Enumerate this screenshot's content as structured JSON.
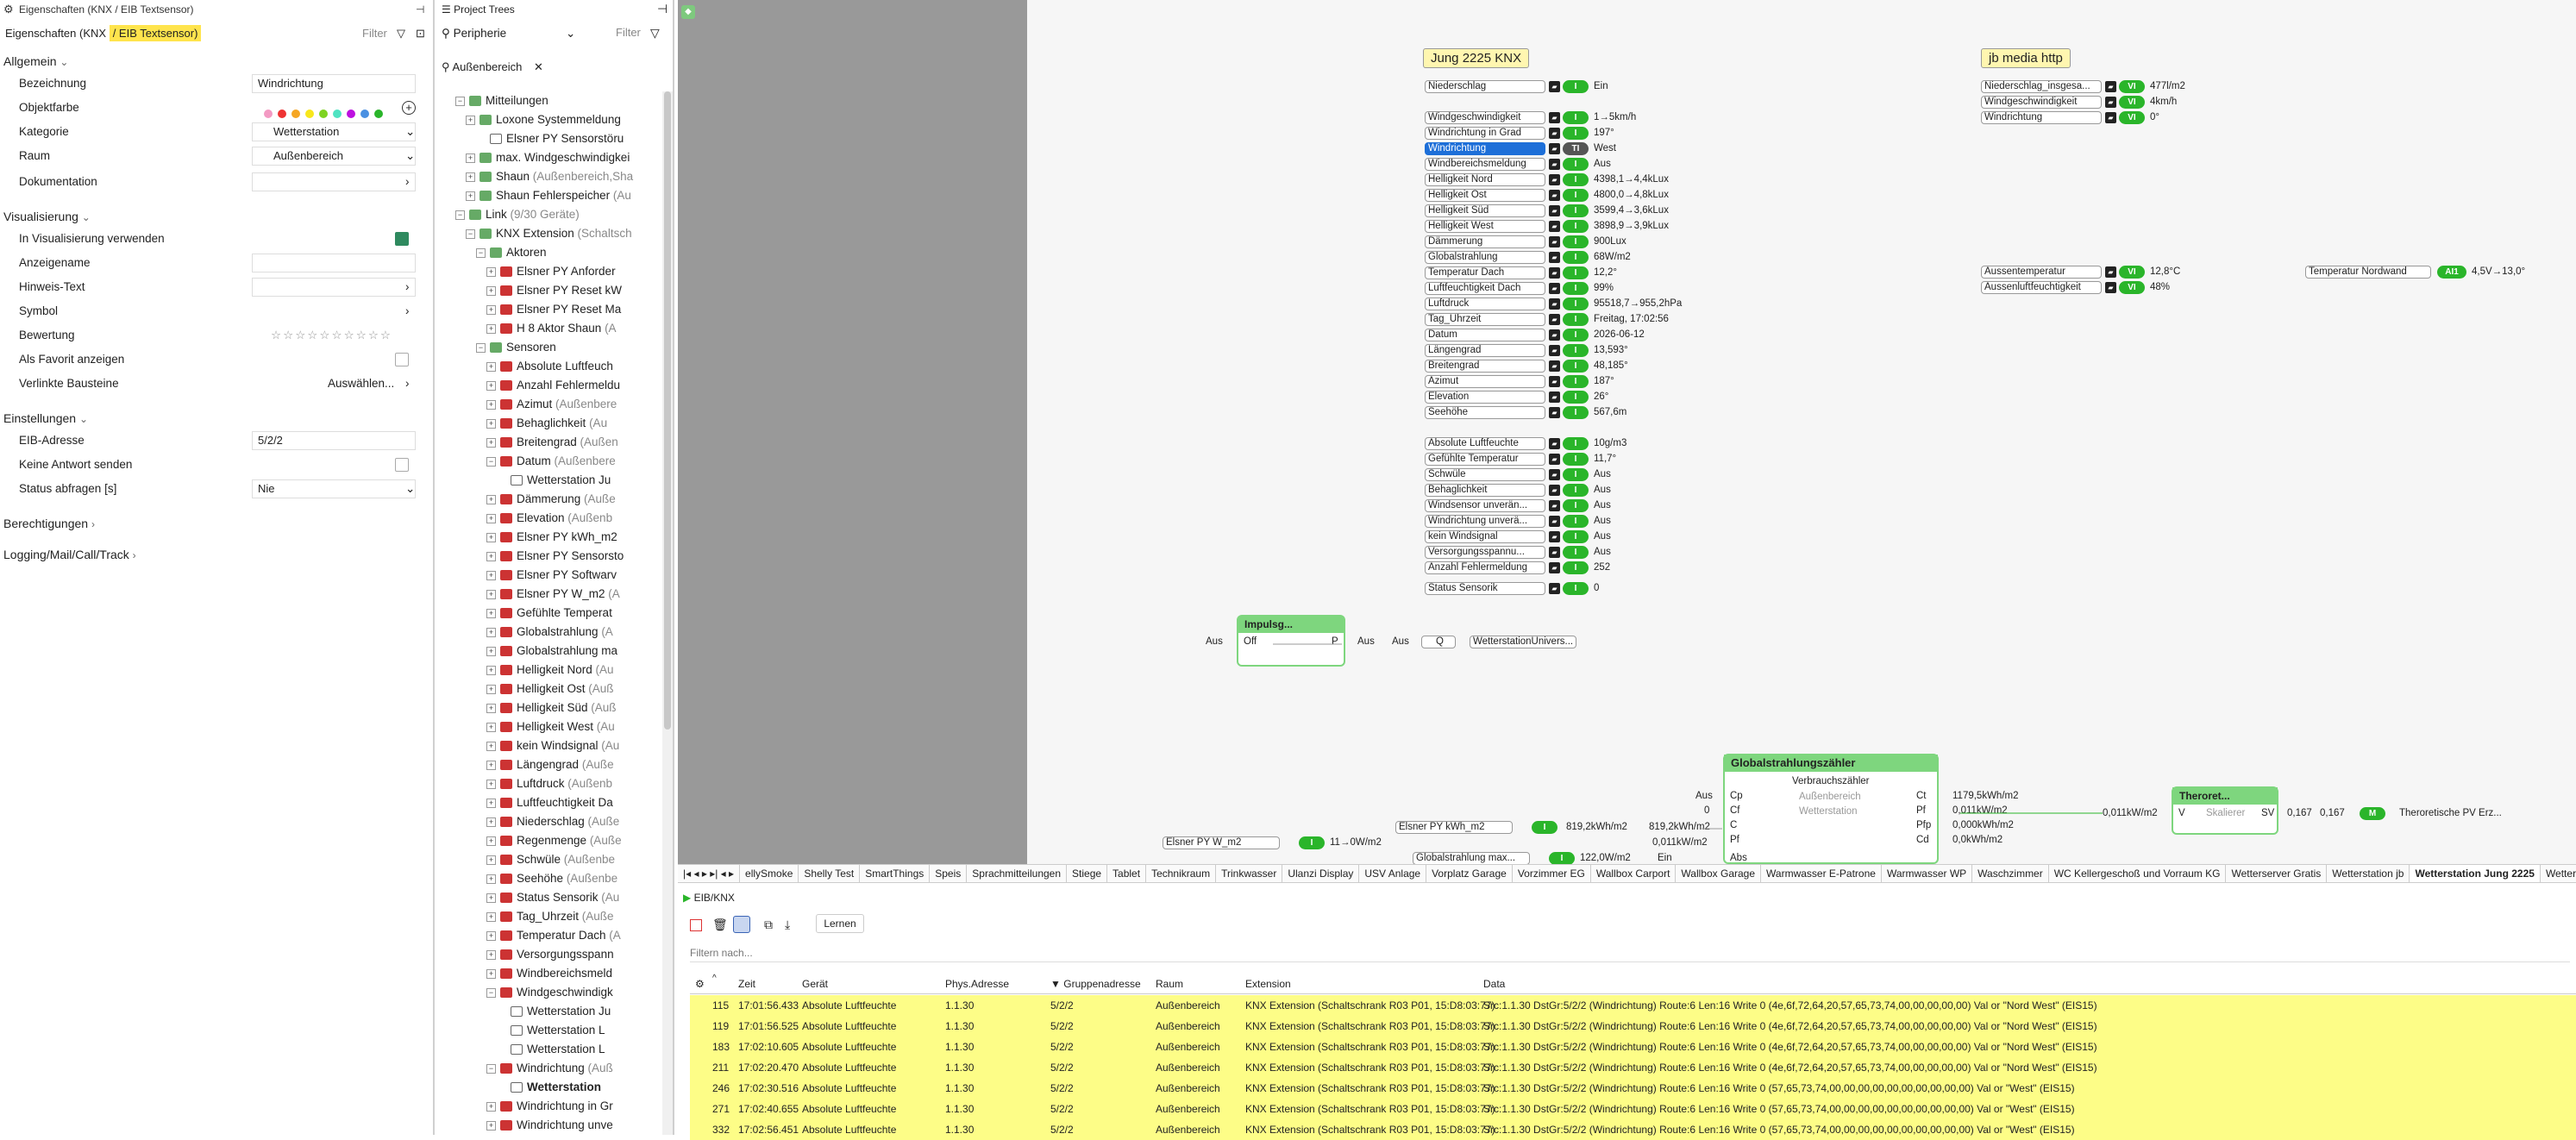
{
  "props": {
    "title": "Eigenschaften (KNX / EIB Textsensor)",
    "subtitle_a": "Eigenschaften (KNX ",
    "subtitle_b": "/ EIB Textsensor)",
    "filter": "Filter",
    "allgemein": "Allgemein",
    "bezeichnung_label": "Bezeichnung",
    "bezeichnung_value": "Windrichtung",
    "objektfarbe_label": "Objektfarbe",
    "kategorie_label": "Kategorie",
    "kategorie_value": "Wetterstation",
    "raum_label": "Raum",
    "raum_value": "Außenbereich",
    "dokumentation_label": "Dokumentation",
    "visualisierung": "Visualisierung",
    "in_vis_label": "In Visualisierung verwenden",
    "anzeigename_label": "Anzeigename",
    "hinweis_label": "Hinweis-Text",
    "symbol_label": "Symbol",
    "bewertung_label": "Bewertung",
    "favorit_label": "Als Favorit anzeigen",
    "verlinkte_label": "Verlinkte Bausteine",
    "verlinkte_value": "Auswählen...",
    "einstellungen": "Einstellungen",
    "eib_label": "EIB-Adresse",
    "eib_value": "5/2/2",
    "keine_antwort_label": "Keine Antwort senden",
    "status_label": "Status abfragen [s]",
    "status_value": "Nie",
    "berechtigungen": "Berechtigungen",
    "logging": "Logging/Mail/Call/Track"
  },
  "tree": {
    "title": "Project Trees",
    "dropdown": "Peripherie",
    "filter": "Filter",
    "breadcrumb": "Außenbereich",
    "nodes": [
      {
        "t": "Mitteilungen",
        "g": ""
      },
      {
        "t": "Loxone Systemmeldung",
        "g": ""
      },
      {
        "t": "Elsner PY Sensorstöru",
        "g": ""
      },
      {
        "t": "max. Windgeschwindigkei",
        "g": ""
      },
      {
        "t": "Shaun",
        "g": " (Außenbereich,Sha"
      },
      {
        "t": "Shaun Fehlerspeicher",
        "g": " (Au"
      },
      {
        "t": "Link",
        "g": " (9/30 Geräte)"
      },
      {
        "t": "KNX Extension",
        "g": " (Schaltsch"
      },
      {
        "t": "Aktoren",
        "g": ""
      },
      {
        "t": "Elsner PY Anforder",
        "g": ""
      },
      {
        "t": "Elsner PY Reset kW",
        "g": ""
      },
      {
        "t": "Elsner PY Reset Ma",
        "g": ""
      },
      {
        "t": "H 8 Aktor Shaun",
        "g": " (A"
      },
      {
        "t": "Sensoren",
        "g": ""
      },
      {
        "t": "Absolute Luftfeuch",
        "g": ""
      },
      {
        "t": "Anzahl Fehlermeldu",
        "g": ""
      },
      {
        "t": "Azimut",
        "g": " (Außenbere"
      },
      {
        "t": "Behaglichkeit",
        "g": " (Au"
      },
      {
        "t": "Breitengrad",
        "g": " (Außen"
      },
      {
        "t": "Datum",
        "g": " (Außenbere"
      },
      {
        "t": "Wetterstation Ju",
        "g": ""
      },
      {
        "t": "Dämmerung",
        "g": " (Auße"
      },
      {
        "t": "Elevation",
        "g": " (Außenb"
      },
      {
        "t": "Elsner PY kWh_m2",
        "g": ""
      },
      {
        "t": "Elsner PY Sensorsto",
        "g": ""
      },
      {
        "t": "Elsner PY Softwarv",
        "g": ""
      },
      {
        "t": "Elsner PY W_m2",
        "g": " (A"
      },
      {
        "t": "Gefühlte Temperat",
        "g": ""
      },
      {
        "t": "Globalstrahlung",
        "g": " (A"
      },
      {
        "t": "Globalstrahlung ma",
        "g": ""
      },
      {
        "t": "Helligkeit Nord",
        "g": " (Au"
      },
      {
        "t": "Helligkeit Ost",
        "g": " (Auß"
      },
      {
        "t": "Helligkeit Süd",
        "g": " (Auß"
      },
      {
        "t": "Helligkeit West",
        "g": " (Au"
      },
      {
        "t": "kein Windsignal",
        "g": " (Au"
      },
      {
        "t": "Längengrad",
        "g": " (Auße"
      },
      {
        "t": "Luftdruck",
        "g": " (Außenb"
      },
      {
        "t": "Luftfeuchtigkeit Da",
        "g": ""
      },
      {
        "t": "Niederschlag",
        "g": " (Auße"
      },
      {
        "t": "Regenmenge",
        "g": " (Auße"
      },
      {
        "t": "Schwüle",
        "g": " (Außenbe"
      },
      {
        "t": "Seehöhe",
        "g": " (Außenbe"
      },
      {
        "t": "Status Sensorik",
        "g": " (Au"
      },
      {
        "t": "Tag_Uhrzeit",
        "g": " (Auße"
      },
      {
        "t": "Temperatur Dach",
        "g": " (A"
      },
      {
        "t": "Versorgungsspann",
        "g": ""
      },
      {
        "t": "Windbereichsmeld",
        "g": ""
      },
      {
        "t": "Windgeschwindigk",
        "g": ""
      },
      {
        "t": "Wetterstation Ju",
        "g": ""
      },
      {
        "t": "Wetterstation L",
        "g": ""
      },
      {
        "t": "Wetterstation L",
        "g": ""
      },
      {
        "t": "Windrichtung",
        "g": " (Auß"
      },
      {
        "t": "Wetterstation",
        "g": ""
      },
      {
        "t": "Windrichtung in Gr",
        "g": ""
      },
      {
        "t": "Windrichtung unve",
        "g": ""
      }
    ]
  },
  "canvas": {
    "jung_title": "Jung 2225 KNX",
    "jbmedia_title": "jb media http",
    "rows1": [
      {
        "n": "Niederschlag",
        "b": "I",
        "v": "Ein"
      }
    ],
    "rows2": [
      {
        "n": "Windgeschwindigkeit",
        "b": "I",
        "v": "1→5km/h"
      },
      {
        "n": "Windrichtung in Grad",
        "b": "I",
        "v": "197°"
      },
      {
        "n": "Windrichtung",
        "b": "TI",
        "v": "West"
      },
      {
        "n": "Windbereichsmeldung",
        "b": "I",
        "v": "Aus"
      },
      {
        "n": "Helligkeit Nord",
        "b": "I",
        "v": "4398,1→4,4kLux"
      },
      {
        "n": "Helligkeit Ost",
        "b": "I",
        "v": "4800,0→4,8kLux"
      },
      {
        "n": "Helligkeit Süd",
        "b": "I",
        "v": "3599,4→3,6kLux"
      },
      {
        "n": "Helligkeit West",
        "b": "I",
        "v": "3898,9→3,9kLux"
      },
      {
        "n": "Dämmerung",
        "b": "I",
        "v": "900Lux"
      },
      {
        "n": "Globalstrahlung",
        "b": "I",
        "v": "68W/m2"
      },
      {
        "n": "Temperatur Dach",
        "b": "I",
        "v": "12,2°"
      },
      {
        "n": "Luftfeuchtigkeit Dach",
        "b": "I",
        "v": "99%"
      },
      {
        "n": "Luftdruck",
        "b": "I",
        "v": "95518,7→955,2hPa"
      },
      {
        "n": "Tag_Uhrzeit",
        "b": "I",
        "v": "Freitag, 17:02:56"
      },
      {
        "n": "Datum",
        "b": "I",
        "v": "2026-06-12"
      },
      {
        "n": "Längengrad",
        "b": "I",
        "v": "13,593°"
      },
      {
        "n": "Breitengrad",
        "b": "I",
        "v": "48,185°"
      },
      {
        "n": "Azimut",
        "b": "I",
        "v": "187°"
      },
      {
        "n": "Elevation",
        "b": "I",
        "v": "26°"
      },
      {
        "n": "Seehöhe",
        "b": "I",
        "v": "567,6m"
      }
    ],
    "rows3": [
      {
        "n": "Absolute Luftfeuchte",
        "b": "I",
        "v": "10g/m3"
      },
      {
        "n": "Gefühlte Temperatur",
        "b": "I",
        "v": "11,7°"
      },
      {
        "n": "Schwüle",
        "b": "I",
        "v": "Aus"
      },
      {
        "n": "Behaglichkeit",
        "b": "I",
        "v": "Aus"
      },
      {
        "n": "Windsensor unverän...",
        "b": "I",
        "v": "Aus"
      },
      {
        "n": "Windrichtung unverä...",
        "b": "I",
        "v": "Aus"
      },
      {
        "n": "kein Windsignal",
        "b": "I",
        "v": "Aus"
      },
      {
        "n": "Versorgungsspannu...",
        "b": "I",
        "v": "Aus"
      },
      {
        "n": "Anzahl Fehlermeldung",
        "b": "I",
        "v": "252"
      }
    ],
    "rows4": [
      {
        "n": "Status Sensorik",
        "b": "I",
        "v": "0"
      }
    ],
    "jb_rows": [
      {
        "n": "Niederschlag_insgesa...",
        "b": "VI",
        "v": "477l/m2"
      },
      {
        "n": "Windgeschwindigkeit",
        "b": "VI",
        "v": "4km/h"
      },
      {
        "n": "Windrichtung",
        "b": "VI",
        "v": "0°"
      }
    ],
    "temp_rows": [
      {
        "n": "Aussentemperatur",
        "b": "VI",
        "v": "12,8°C"
      },
      {
        "n": "Aussenluftfeuchtigkeit",
        "b": "VI",
        "v": "48%"
      }
    ],
    "nordwand": {
      "n": "Temperatur Nordwand",
      "b": "AI1",
      "v": "4,5V→13,0°"
    },
    "impuls_title": "Impulsg...",
    "impuls_off": "Off",
    "impuls_p": "P",
    "aus": "Aus",
    "q": "Q",
    "wetterstation_univ": "WetterstationUnivers...",
    "global_title": "Globalstrahlungszähler",
    "global_sub": "Verbrauchszähler",
    "global_room": "Außenbereich",
    "global_cat": "Wetterstation",
    "global_ports_left": [
      "Cp",
      "Cf",
      "C",
      "Pf"
    ],
    "global_ports_right": [
      "Ct",
      "Pf",
      "Pfp",
      "Cd"
    ],
    "global_vals_right": [
      "1179,5kWh/m2",
      "0,011kW/m2",
      "0,000kWh/m2",
      "0,0kWh/m2"
    ],
    "global_inputs": [
      "Aus",
      "0"
    ],
    "elsner_kwh": "Elsner PY kWh_m2",
    "elsner_kwh_v": "819,2kWh/m2",
    "elsner_kwh_v2": "819,2kWh/m2",
    "elsner_w": "Elsner PY W_m2",
    "elsner_w_v": "11→0W/m2",
    "elsner_w_v2": "0,011kW/m2",
    "global_max": "Globalstrahlung max...",
    "global_max_v": "122,0W/m2",
    "ein": "Ein",
    "abs": "Abs",
    "theo_title": "Theroret...",
    "theo_v": "V",
    "theo_sv": "SV",
    "theo_skal": "Skalierer",
    "theo_in": "0,011kW/m2",
    "theo_out1": "0,167",
    "theo_out2": "0,167",
    "theo_badge": "M",
    "theo_target": "Theroretische PV Erz..."
  },
  "tabs": [
    "ellySmoke",
    "Shelly Test",
    "SmartThings",
    "Speis",
    "Sprachmitteilungen",
    "Stiege",
    "Tablet",
    "Technikraum",
    "Trinkwasser",
    "Ulanzi Display",
    "USV Anlage",
    "Vorplatz Garage",
    "Vorzimmer EG",
    "Wallbox Carport",
    "Wallbox Garage",
    "Warmwasser E-Patrone",
    "Warmwasser WP",
    "Waschzimmer",
    "WC Kellergeschoß und Vorraum KG",
    "Wetterserver Gratis",
    "Wetterstation jb",
    "Wetterstation Jung 2225",
    "Wetterstation Lo"
  ],
  "monitor": {
    "title": "EIB/KNX",
    "lernen": "Lernen",
    "filter_placeholder": "Filtern nach...",
    "headers": [
      "Zeit",
      "Gerät",
      "Phys.Adresse",
      "Gruppenadresse",
      "Raum",
      "Extension",
      "Data"
    ],
    "rows": [
      [
        "115",
        "17:01:56.433",
        "Absolute Luftfeuchte",
        "1.1.30",
        "5/2/2",
        "Außenbereich",
        "KNX Extension (Schaltschrank R03 P01, 15:D8:03:77)",
        "Src:1.1.30  DstGr:5/2/2  (Windrichtung)  Route:6 Len:16  Write 0  (4e,6f,72,64,20,57,65,73,74,00,00,00,00,00)  Val or \"Nord West\" (EIS15)"
      ],
      [
        "119",
        "17:01:56.525",
        "Absolute Luftfeuchte",
        "1.1.30",
        "5/2/2",
        "Außenbereich",
        "KNX Extension (Schaltschrank R03 P01, 15:D8:03:77)",
        "Src:1.1.30  DstGr:5/2/2  (Windrichtung)  Route:6 Len:16  Write 0  (4e,6f,72,64,20,57,65,73,74,00,00,00,00,00)  Val or \"Nord West\" (EIS15)"
      ],
      [
        "183",
        "17:02:10.605",
        "Absolute Luftfeuchte",
        "1.1.30",
        "5/2/2",
        "Außenbereich",
        "KNX Extension (Schaltschrank R03 P01, 15:D8:03:77)",
        "Src:1.1.30  DstGr:5/2/2  (Windrichtung)  Route:6 Len:16  Write 0  (4e,6f,72,64,20,57,65,73,74,00,00,00,00,00)  Val or \"Nord West\" (EIS15)"
      ],
      [
        "211",
        "17:02:20.470",
        "Absolute Luftfeuchte",
        "1.1.30",
        "5/2/2",
        "Außenbereich",
        "KNX Extension (Schaltschrank R03 P01, 15:D8:03:77)",
        "Src:1.1.30  DstGr:5/2/2  (Windrichtung)  Route:6 Len:16  Write 0  (4e,6f,72,64,20,57,65,73,74,00,00,00,00,00)  Val or \"Nord West\" (EIS15)"
      ],
      [
        "246",
        "17:02:30.516",
        "Absolute Luftfeuchte",
        "1.1.30",
        "5/2/2",
        "Außenbereich",
        "KNX Extension (Schaltschrank R03 P01, 15:D8:03:77)",
        "Src:1.1.30  DstGr:5/2/2  (Windrichtung)  Route:6 Len:16  Write 0  (57,65,73,74,00,00,00,00,00,00,00,00,00,00)  Val or \"West\" (EIS15)"
      ],
      [
        "271",
        "17:02:40.655",
        "Absolute Luftfeuchte",
        "1.1.30",
        "5/2/2",
        "Außenbereich",
        "KNX Extension (Schaltschrank R03 P01, 15:D8:03:77)",
        "Src:1.1.30  DstGr:5/2/2  (Windrichtung)  Route:6 Len:16  Write 0  (57,65,73,74,00,00,00,00,00,00,00,00,00,00)  Val or \"West\" (EIS15)"
      ],
      [
        "332",
        "17:02:56.451",
        "Absolute Luftfeuchte",
        "1.1.30",
        "5/2/2",
        "Außenbereich",
        "KNX Extension (Schaltschrank R03 P01, 15:D8:03:77)",
        "Src:1.1.30  DstGr:5/2/2  (Windrichtung)  Route:6 Len:16  Write 0  (57,65,73,74,00,00,00,00,00,00,00,00,00,00)  Val or \"West\" (EIS15)"
      ]
    ]
  },
  "colors": {
    "accent": "#2ab52a",
    "highlight": "#ffe44d",
    "rowYellow": "#fdfd87",
    "canvasGray": "#999999"
  }
}
